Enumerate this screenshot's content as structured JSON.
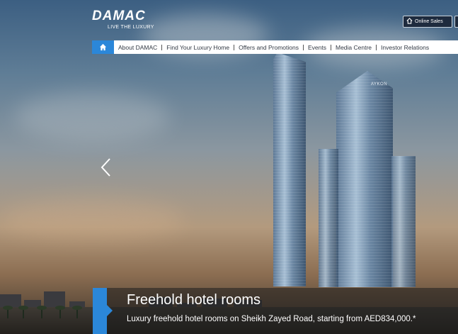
{
  "brand": {
    "logo_text": "DAMAC",
    "tagline": "LIVE THE LUXURY"
  },
  "header": {
    "online_sales_label": "Online Sales",
    "online_sales_icon": "house-icon"
  },
  "nav": {
    "home_icon": "home-icon",
    "home_color": "#2b87d9",
    "items": [
      {
        "label": "About DAMAC"
      },
      {
        "label": "Find Your Luxury Home"
      },
      {
        "label": "Offers and Promotions"
      },
      {
        "label": "Events"
      },
      {
        "label": "Media Centre"
      },
      {
        "label": "Investor Relations"
      }
    ]
  },
  "hero": {
    "building_sign": "AYKON",
    "prev_icon": "chevron-left-icon"
  },
  "caption": {
    "title": "Freehold hotel rooms",
    "subtitle": "Luxury freehold hotel rooms on Sheikh Zayed Road, starting from AED834,000.*",
    "accent_color": "#2b87d9"
  }
}
